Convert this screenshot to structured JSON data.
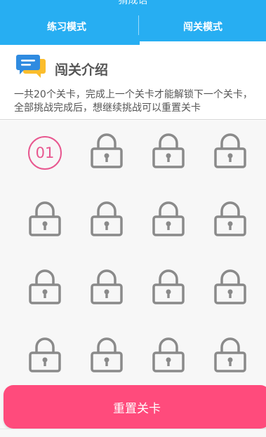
{
  "header": {
    "title": "猜成语",
    "bg_color": "#27aef2",
    "tabs": [
      {
        "label": "练习模式",
        "active": false
      },
      {
        "label": "闯关模式",
        "active": true
      }
    ]
  },
  "intro": {
    "icon": "chat-bubbles-icon",
    "title": "闯关介绍",
    "description": "一共20个关卡，完成上一个关卡才能解锁下一个关卡，全部挑战完成后，想继续挑战可以重置关卡"
  },
  "levels": [
    {
      "label": "01",
      "locked": false
    },
    {
      "label": "",
      "locked": true
    },
    {
      "label": "",
      "locked": true
    },
    {
      "label": "",
      "locked": true
    },
    {
      "label": "",
      "locked": true
    },
    {
      "label": "",
      "locked": true
    },
    {
      "label": "",
      "locked": true
    },
    {
      "label": "",
      "locked": true
    },
    {
      "label": "",
      "locked": true
    },
    {
      "label": "",
      "locked": true
    },
    {
      "label": "",
      "locked": true
    },
    {
      "label": "",
      "locked": true
    },
    {
      "label": "",
      "locked": true
    },
    {
      "label": "",
      "locked": true
    },
    {
      "label": "",
      "locked": true
    },
    {
      "label": "",
      "locked": true
    }
  ],
  "level_icon": "lock-icon",
  "colors": {
    "accent_pink": "#e8578f",
    "reset_button": "#ff4b7c",
    "lock_gray": "#8a8a8a"
  },
  "reset_button_label": "重置关卡"
}
